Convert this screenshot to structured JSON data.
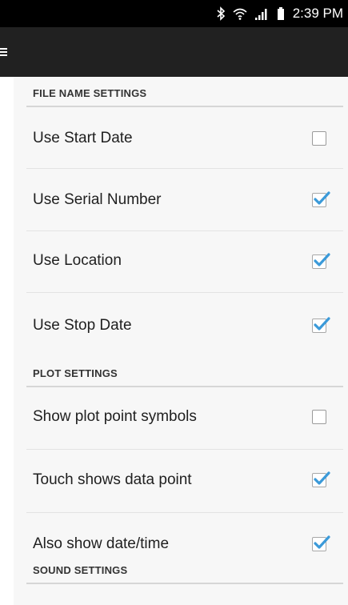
{
  "status_bar": {
    "time": "2:39 PM",
    "icons": [
      "bluetooth-icon",
      "wifi-icon",
      "signal-icon",
      "battery-icon"
    ]
  },
  "app_bar": {
    "menu_icon": "hamburger-menu-icon"
  },
  "colors": {
    "check_accent": "#3b9ad9",
    "app_bar": "#212121",
    "status_bar": "#000000",
    "content_bg": "#f7f7f7"
  },
  "sections": {
    "file_name": {
      "header": "FILE NAME SETTINGS",
      "items": [
        {
          "label": "Use Start Date",
          "checked": false
        },
        {
          "label": "Use Serial Number",
          "checked": true
        },
        {
          "label": "Use Location",
          "checked": true
        },
        {
          "label": "Use Stop Date",
          "checked": true
        }
      ]
    },
    "plot": {
      "header": "PLOT SETTINGS",
      "items": [
        {
          "label": "Show plot point symbols",
          "checked": false
        },
        {
          "label": "Touch shows data point",
          "checked": true
        },
        {
          "label": "Also show date/time",
          "checked": true
        }
      ]
    },
    "sound": {
      "header": "SOUND SETTINGS"
    }
  }
}
